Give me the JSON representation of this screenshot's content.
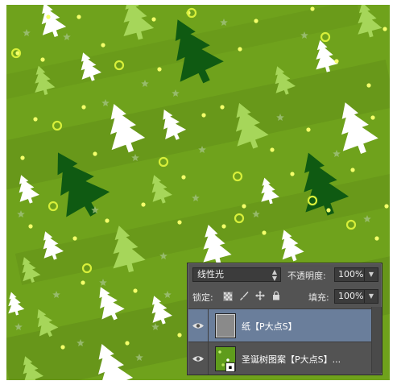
{
  "canvas": {
    "background_color": "#6fa21c",
    "tree_colors": {
      "dark": "#0f5a12",
      "light": "#a6d65a",
      "white": "#ffffff"
    },
    "dot_color": "#f4ff6a",
    "ring_color": "#d7ef3a",
    "star_color": "#9fc07a"
  },
  "layers_panel": {
    "blend_mode": "线性光",
    "opacity_label": "不透明度:",
    "opacity_value": "100%",
    "lock_label": "锁定:",
    "fill_label": "填充:",
    "fill_value": "100%",
    "layers": [
      {
        "name": "纸【P大点S】",
        "selected": true,
        "thumbnail": "paper"
      },
      {
        "name": "圣诞树图案【P大点S】...",
        "selected": false,
        "thumbnail": "pattern"
      }
    ],
    "icons": {
      "eye": "eye-icon",
      "lock_pixels": "lock-transparent-pixels-icon",
      "lock_brush": "brush-icon",
      "lock_move": "move-icon",
      "lock_all": "lock-icon"
    }
  }
}
